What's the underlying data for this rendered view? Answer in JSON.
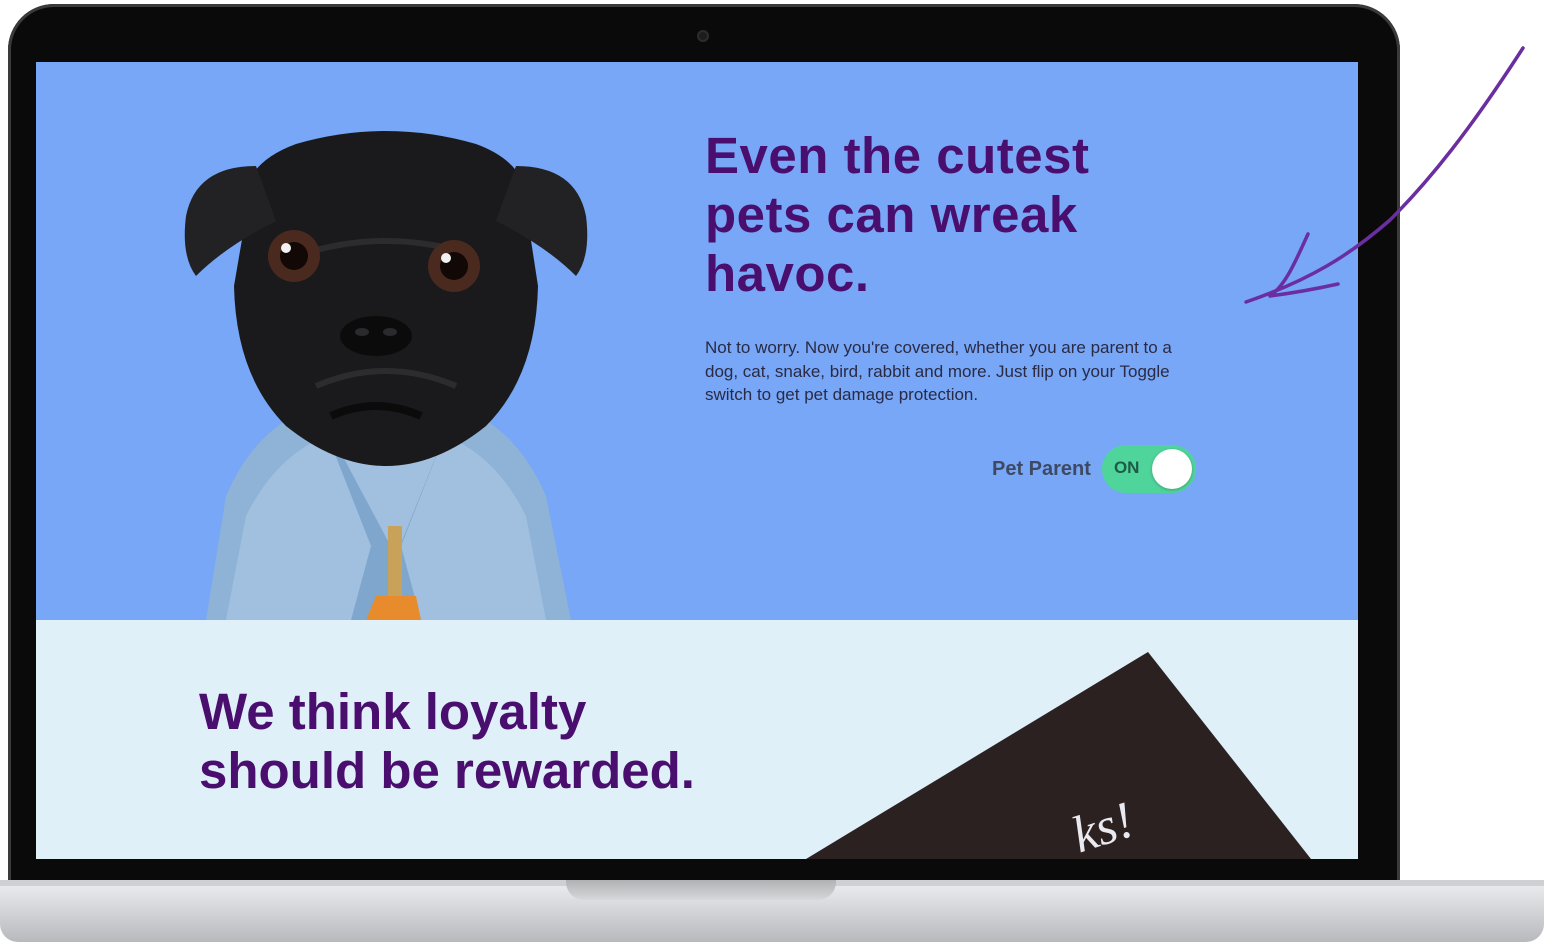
{
  "hero": {
    "title": "Even the cutest pets can wreak havoc.",
    "body": "Not to worry. Now you're covered, whether you are parent to a dog, cat, snake, bird, rabbit and more. Just flip on your Toggle switch to get pet damage protection.",
    "toggle_label": "Pet Parent",
    "toggle_state": "ON",
    "toggle_on": true
  },
  "loyalty": {
    "title": "We think loyalty should be rewarded.",
    "card_text": "ks!"
  },
  "colors": {
    "hero_bg": "#77a7f6",
    "loyalty_bg": "#dff0f9",
    "heading_purple": "#4a0f6e",
    "toggle_green": "#4fd59b",
    "annotation_arrow": "#6a2ea0"
  },
  "icons": {
    "pug": "pug-photo",
    "arrow": "annotation-arrow-icon"
  }
}
